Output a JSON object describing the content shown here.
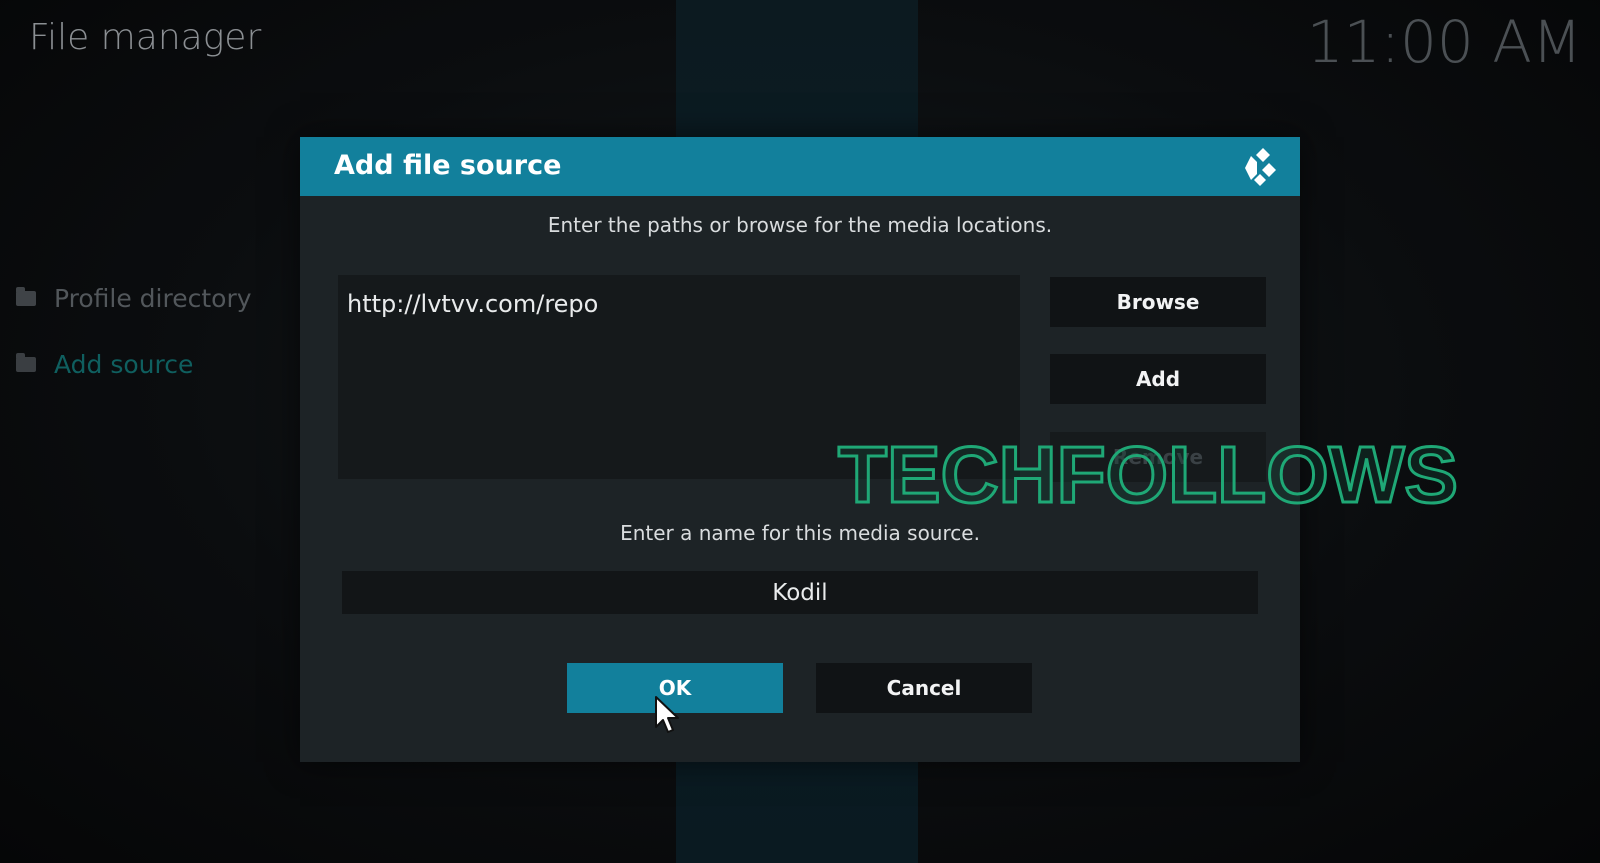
{
  "window": {
    "title": "File manager",
    "clock": "11:00 AM"
  },
  "sidebar": {
    "items": [
      {
        "label": "Profile directory",
        "icon": "folder-icon"
      },
      {
        "label": "Add source",
        "icon": "folder-icon"
      }
    ]
  },
  "dialog": {
    "title": "Add file source",
    "logo": "kodi-logo-icon",
    "paths_prompt": "Enter the paths or browse for the media locations.",
    "path_entry": "http://lvtvv.com/repo",
    "buttons": {
      "browse": "Browse",
      "add": "Add",
      "remove": "Remove",
      "ok": "OK",
      "cancel": "Cancel"
    },
    "name_prompt": "Enter a name for this media source.",
    "name_value": "Kodil"
  },
  "watermark": {
    "text": "TECHFOLLOWS"
  },
  "colors": {
    "accent": "#12809c",
    "watermark": "#1fa876"
  }
}
